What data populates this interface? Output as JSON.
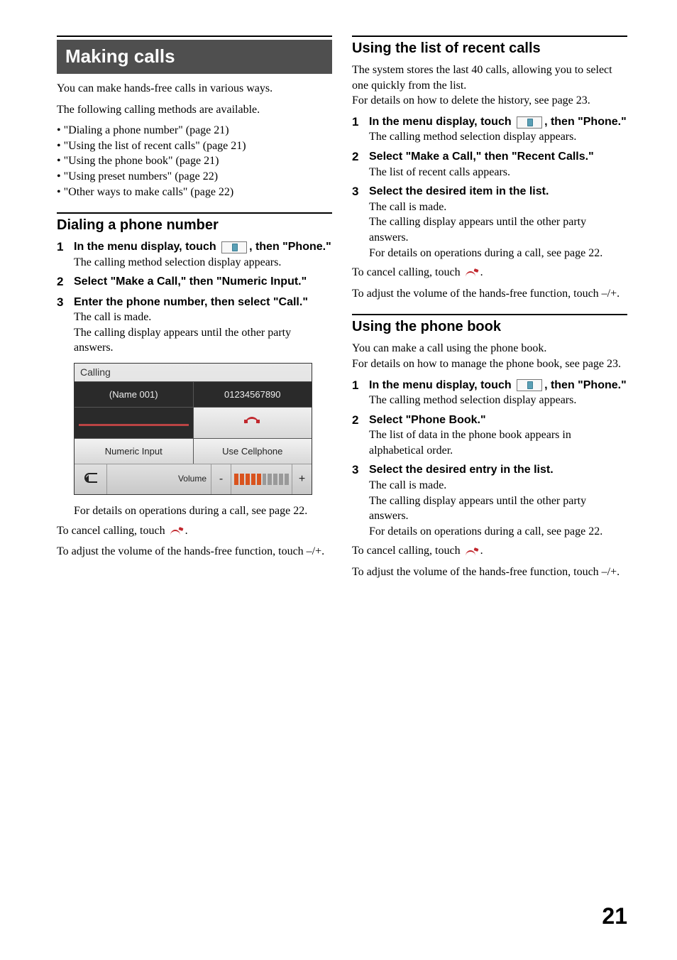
{
  "page_number": "21",
  "left": {
    "heading": "Making calls",
    "intro1": "You can make hands-free calls in various ways.",
    "intro2": "The following calling methods are available.",
    "bullets": [
      "\"Dialing a phone number\" (page 21)",
      "\"Using the list of recent calls\" (page 21)",
      "\"Using the phone book\" (page 21)",
      "\"Using preset numbers\" (page 22)",
      "\"Other ways to make calls\" (page 22)"
    ],
    "dial": {
      "title": "Dialing a phone number",
      "s1a": "In the menu display, touch ",
      "s1b": ", then \"Phone.\"",
      "s1r": "The calling method selection display appears.",
      "s2a": "Select \"Make a Call,\" then \"Numeric Input.\"",
      "s3a": "Enter the phone number, then select \"Call.\"",
      "s3r1": "The call is made.",
      "s3r2": "The calling display appears until the other party answers.",
      "after_img": "For details on operations during a call, see page 22.",
      "cancel_a": "To cancel calling, touch ",
      "cancel_b": ".",
      "vol": "To adjust the volume of the hands-free function, touch –/+."
    },
    "calling_display": {
      "title": "Calling",
      "name": "(Name 001)",
      "number": "01234567890",
      "btn1": "Numeric Input",
      "btn2": "Use Cellphone",
      "volume": "Volume"
    }
  },
  "right": {
    "recent": {
      "title": "Using the list of recent calls",
      "intro1": "The system stores the last 40 calls, allowing you to select one quickly from the list.",
      "intro2": "For details on how to delete the history, see page 23.",
      "s1a": "In the menu display, touch ",
      "s1b": ", then \"Phone.\"",
      "s1r": "The calling method selection display appears.",
      "s2a": "Select \"Make a Call,\" then \"Recent Calls.\"",
      "s2r": "The list of recent calls appears.",
      "s3a": "Select the desired item in the list.",
      "s3r1": "The call is made.",
      "s3r2": "The calling display appears until the other party answers.",
      "s3r3": "For details on operations during a call, see page 22.",
      "cancel_a": "To cancel calling, touch ",
      "cancel_b": ".",
      "vol": "To adjust the volume of the hands-free function, touch –/+."
    },
    "pbook": {
      "title": "Using the phone book",
      "intro1": "You can make a call using the phone book.",
      "intro2": "For details on how to manage the phone book, see page 23.",
      "s1a": "In the menu display, touch ",
      "s1b": ", then \"Phone.\"",
      "s1r": "The calling method selection display appears.",
      "s2a": "Select \"Phone Book.\"",
      "s2r": "The list of data in the phone book appears in alphabetical order.",
      "s3a": "Select the desired entry in the list.",
      "s3r1": "The call is made.",
      "s3r2": "The calling display appears until the other party answers.",
      "s3r3": "For details on operations during a call, see page 22.",
      "cancel_a": "To cancel calling, touch ",
      "cancel_b": ".",
      "vol": "To adjust the volume of the hands-free function, touch –/+."
    }
  }
}
